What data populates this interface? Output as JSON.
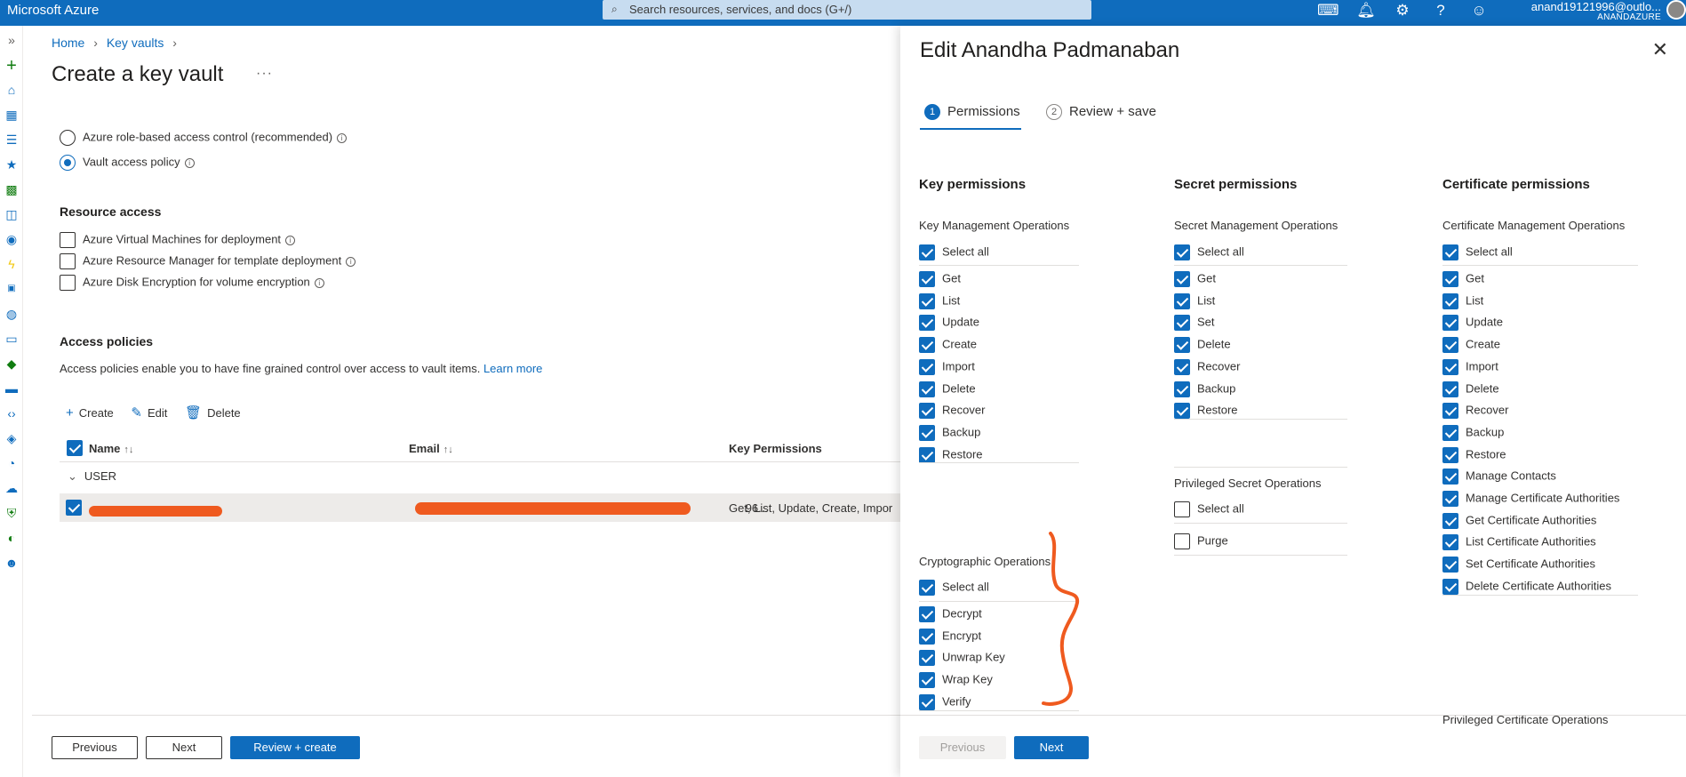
{
  "topbar": {
    "brand": "Microsoft Azure",
    "search_placeholder": "Search resources, services, and docs (G+/)",
    "account_email": "anand19121996@outlo...",
    "account_directory": "ANANDAZURE",
    "icons": [
      "cloud-shell-icon",
      "notifications-icon",
      "settings-icon",
      "help-icon",
      "feedback-icon"
    ],
    "accent": "#0f6cbd"
  },
  "rail": {
    "icons": [
      "expand-icon",
      "create-resource-icon",
      "home-icon",
      "dashboard-icon",
      "all-services-icon",
      "favorites-icon",
      "all-resources-icon",
      "resource-groups-icon",
      "app-services-icon",
      "function-app-icon",
      "sql-icon",
      "cosmos-icon",
      "virtual-machines-icon",
      "load-balancer-icon",
      "storage-icon",
      "virtual-network-icon",
      "entra-icon",
      "monitor-icon",
      "advisor-icon",
      "defender-icon",
      "cost-icon",
      "help-support-icon"
    ]
  },
  "breadcrumb": {
    "home": "Home",
    "keyvaults": "Key vaults"
  },
  "main": {
    "title": "Create a key vault",
    "more": "···",
    "permission_model": {
      "rbac": "Azure role-based access control (recommended)",
      "vault_policy": "Vault access policy"
    },
    "resource_access": {
      "heading": "Resource access",
      "vm": "Azure Virtual Machines for deployment",
      "arm": "Azure Resource Manager for template deployment",
      "disk": "Azure Disk Encryption for volume encryption"
    },
    "access_policies": {
      "heading": "Access policies",
      "description": "Access policies enable you to have fine grained control over access to vault items.",
      "learn_more": "Learn more",
      "create": "Create",
      "edit": "Edit",
      "delete": "Delete",
      "col_name": "Name",
      "col_email": "Email",
      "col_key_permissions": "Key Permissions",
      "group": "USER",
      "row": {
        "email_suffix": "96...",
        "key_permissions": "Get, List, Update, Create, Impor"
      }
    },
    "footer": {
      "previous": "Previous",
      "next": "Next",
      "review_create": "Review + create"
    }
  },
  "panel": {
    "title": "Edit Anandha Padmanaban",
    "close": "✕",
    "steps": [
      {
        "num": "1",
        "label": "Permissions"
      },
      {
        "num": "2",
        "label": "Review + save"
      }
    ],
    "key": {
      "heading": "Key permissions",
      "mgmt_group": "Key Management Operations",
      "select_all": "Select all",
      "mgmt_items": [
        "Get",
        "List",
        "Update",
        "Create",
        "Import",
        "Delete",
        "Recover",
        "Backup",
        "Restore"
      ],
      "crypto_group": "Cryptographic Operations",
      "crypto_items": [
        "Decrypt",
        "Encrypt",
        "Unwrap Key",
        "Wrap Key",
        "Verify"
      ]
    },
    "secret": {
      "heading": "Secret permissions",
      "mgmt_group": "Secret Management Operations",
      "select_all": "Select all",
      "mgmt_items": [
        "Get",
        "List",
        "Set",
        "Delete",
        "Recover",
        "Backup",
        "Restore"
      ],
      "priv_group": "Privileged Secret Operations",
      "priv_items": [
        "Purge"
      ]
    },
    "certificate": {
      "heading": "Certificate permissions",
      "mgmt_group": "Certificate Management Operations",
      "select_all": "Select all",
      "mgmt_items": [
        "Get",
        "List",
        "Update",
        "Create",
        "Import",
        "Delete",
        "Recover",
        "Backup",
        "Restore",
        "Manage Contacts",
        "Manage Certificate Authorities",
        "Get Certificate Authorities",
        "List Certificate Authorities",
        "Set Certificate Authorities",
        "Delete Certificate Authorities"
      ],
      "priv_group": "Privileged Certificate Operations"
    },
    "footer": {
      "previous": "Previous",
      "next": "Next"
    }
  }
}
